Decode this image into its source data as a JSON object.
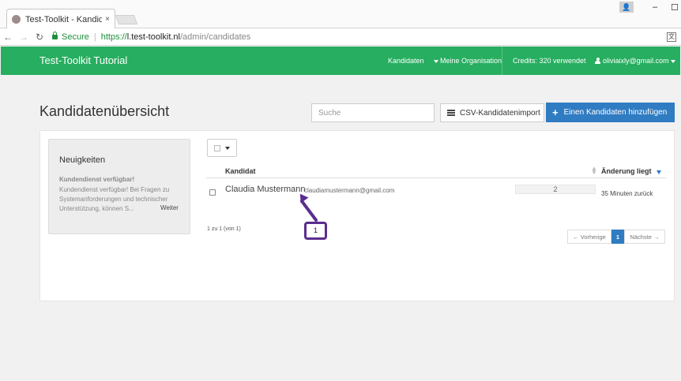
{
  "browser": {
    "tab_title": "Test-Toolkit - Kandidaten",
    "tab_close": "×",
    "secure_label": "Secure",
    "url_proto": "https://",
    "url_host": "l.test-toolkit.nl",
    "url_path": "/admin/candidates",
    "window_minimize": "–",
    "window_maximize": "☐"
  },
  "navbar": {
    "brand": "Test-Toolkit Tutorial",
    "candidates": "Kandidaten",
    "organisation": "Meine Organisation",
    "credits": "Credits: 320 verwendet",
    "user": "oliviaixly@gmail.com",
    "color": "#27ae60"
  },
  "page": {
    "title": "Kandidatenübersicht",
    "search_placeholder": "Suche",
    "csv_import": "CSV-Kandidatenimport",
    "add_candidate": "Einen Kandidaten hinzufügen",
    "accent": "#2f7cc2"
  },
  "news": {
    "title": "Neuigkeiten",
    "headline": "Kundendienst verfügbar!",
    "body": "Kundendienst verfügbar! Bei Fragen zu Systemanforderungen und technischer Unterstützung, können S...",
    "more": "Weiter"
  },
  "table": {
    "headers": {
      "candidate": "Kandidat",
      "last_change": "Änderung liegt"
    },
    "rows": [
      {
        "name": "Claudia Mustermann",
        "email": "claudiamustermann@gmail.com",
        "count": "2",
        "time": "35 Minuten zurück"
      }
    ],
    "result_info": "1 zu 1 (von 1)"
  },
  "pagination": {
    "prev": "← Vorherige",
    "current": "1",
    "next": "Nächste →"
  },
  "annotation": {
    "label": "1",
    "color": "#5b2d8e"
  }
}
